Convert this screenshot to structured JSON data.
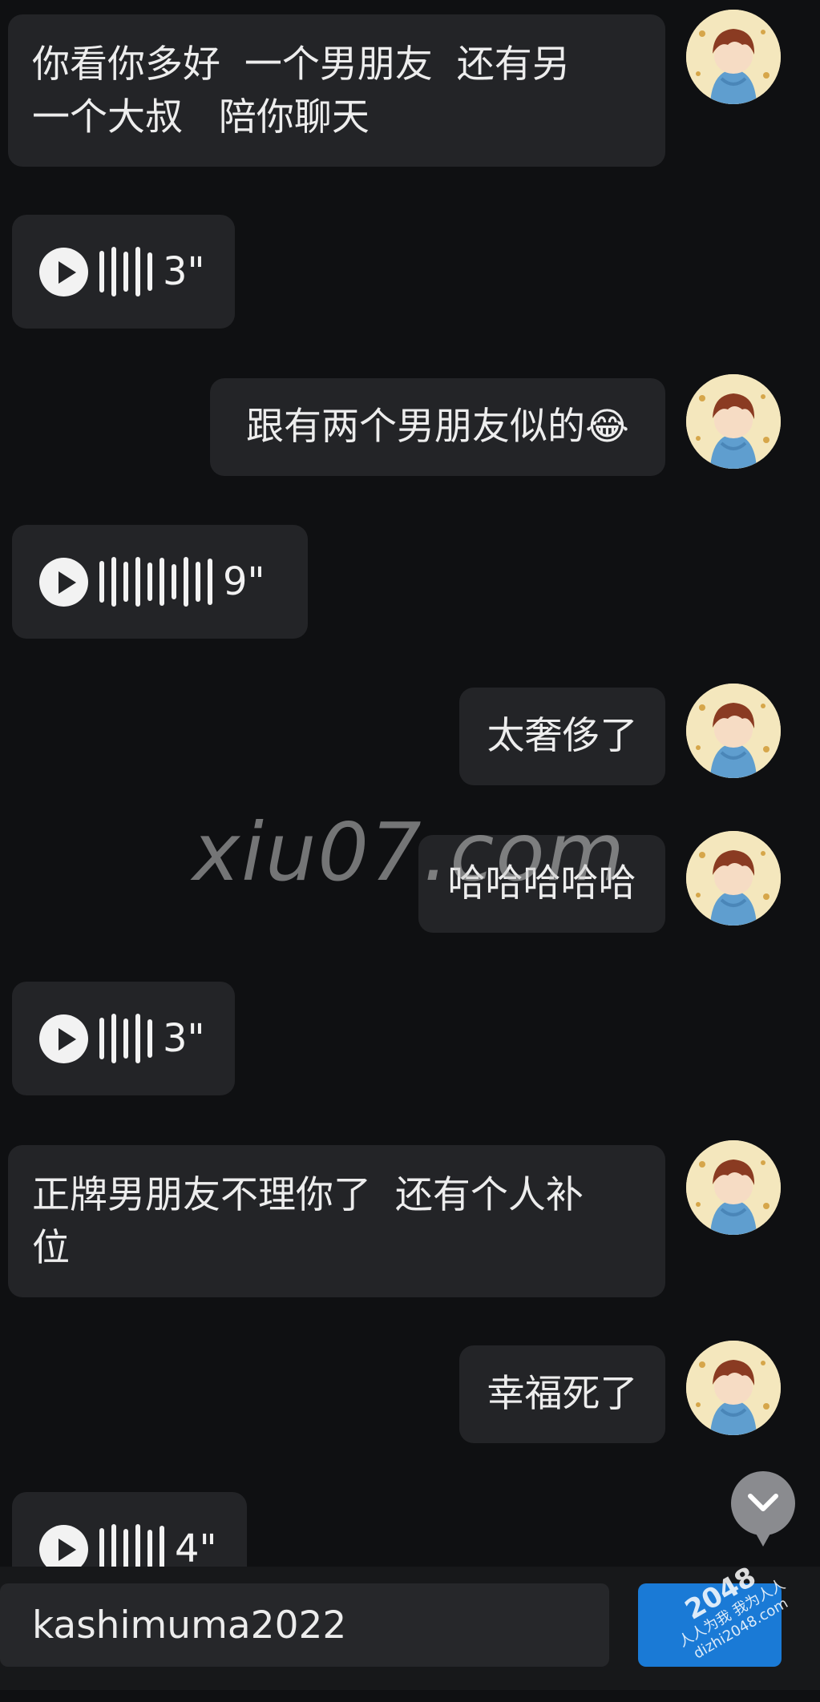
{
  "messages": [
    {
      "type": "text",
      "side": "right",
      "text": "你看你多好  一个男朋友  还有另\n一个大叔   陪你聊天"
    },
    {
      "type": "voice",
      "side": "left",
      "duration": "3\""
    },
    {
      "type": "text",
      "side": "right",
      "text": "跟有两个男朋友似的😂"
    },
    {
      "type": "voice",
      "side": "left",
      "duration": "9\""
    },
    {
      "type": "text",
      "side": "right",
      "text": "太奢侈了"
    },
    {
      "type": "text",
      "side": "right",
      "text": "哈哈哈哈哈"
    },
    {
      "type": "voice",
      "side": "left",
      "duration": "3\""
    },
    {
      "type": "text",
      "side": "right",
      "text": "正牌男朋友不理你了  还有个人补\n位"
    },
    {
      "type": "text",
      "side": "right",
      "text": "幸福死了"
    },
    {
      "type": "voice",
      "side": "left",
      "duration": "4\""
    }
  ],
  "watermark": "xiu07.com",
  "input": {
    "value": "kashimuma2022"
  },
  "send_button": {
    "label": ""
  },
  "stamp": {
    "line1": "2048",
    "line2": "人人为我 我为人人",
    "line3": "dizhi2048.com"
  },
  "icons": {
    "scroll_down": "chevron-down-icon",
    "play": "play-icon"
  },
  "colors": {
    "background": "#0f1012",
    "bubble": "#232427",
    "send": "#1a7ad6"
  }
}
